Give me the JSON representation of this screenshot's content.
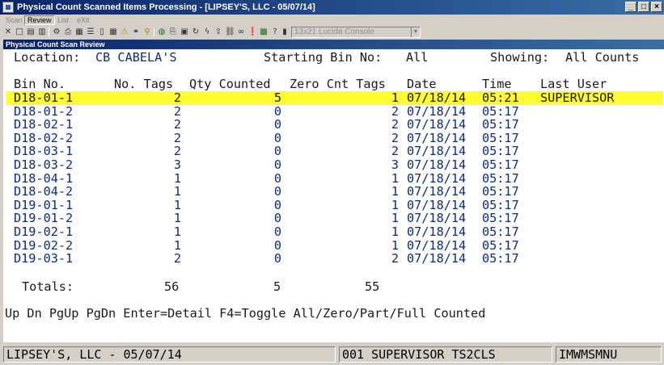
{
  "window": {
    "title": "Physical Count Scanned Items Processing - [LIPSEY'S, LLC - 05/07/14]"
  },
  "menu": [
    "Scan",
    "Review",
    "List",
    "eXit"
  ],
  "toolbar": {
    "font_select": "13x21 Lucida Console"
  },
  "child_window": {
    "title": "Physical Count Scan Review"
  },
  "header": {
    "location_label": "Location:",
    "location_value": "CB CABELA'S",
    "starting_bin_label": "Starting Bin No:",
    "starting_bin_value": "All",
    "showing_label": "Showing:",
    "showing_value": "All Counts"
  },
  "table": {
    "columns": [
      "Bin No.",
      "No. Tags",
      "Qty Counted",
      "Zero Cnt Tags",
      "Date",
      "Time",
      "Last User"
    ],
    "rows": [
      {
        "bin": "D18-01-1",
        "tags": "2",
        "qty": "5",
        "zero": "1",
        "date": "07/18/14",
        "time": "05:21",
        "user": "SUPERVISOR"
      },
      {
        "bin": "D18-01-2",
        "tags": "2",
        "qty": "0",
        "zero": "2",
        "date": "07/18/14",
        "time": "05:17",
        "user": ""
      },
      {
        "bin": "D18-02-1",
        "tags": "2",
        "qty": "0",
        "zero": "2",
        "date": "07/18/14",
        "time": "05:17",
        "user": ""
      },
      {
        "bin": "D18-02-2",
        "tags": "2",
        "qty": "0",
        "zero": "2",
        "date": "07/18/14",
        "time": "05:17",
        "user": ""
      },
      {
        "bin": "D18-03-1",
        "tags": "2",
        "qty": "0",
        "zero": "2",
        "date": "07/18/14",
        "time": "05:17",
        "user": ""
      },
      {
        "bin": "D18-03-2",
        "tags": "3",
        "qty": "0",
        "zero": "3",
        "date": "07/18/14",
        "time": "05:17",
        "user": ""
      },
      {
        "bin": "D18-04-1",
        "tags": "1",
        "qty": "0",
        "zero": "1",
        "date": "07/18/14",
        "time": "05:17",
        "user": ""
      },
      {
        "bin": "D18-04-2",
        "tags": "1",
        "qty": "0",
        "zero": "1",
        "date": "07/18/14",
        "time": "05:17",
        "user": ""
      },
      {
        "bin": "D19-01-1",
        "tags": "1",
        "qty": "0",
        "zero": "1",
        "date": "07/18/14",
        "time": "05:17",
        "user": ""
      },
      {
        "bin": "D19-01-2",
        "tags": "1",
        "qty": "0",
        "zero": "1",
        "date": "07/18/14",
        "time": "05:17",
        "user": ""
      },
      {
        "bin": "D19-02-1",
        "tags": "1",
        "qty": "0",
        "zero": "1",
        "date": "07/18/14",
        "time": "05:17",
        "user": ""
      },
      {
        "bin": "D19-02-2",
        "tags": "1",
        "qty": "0",
        "zero": "1",
        "date": "07/18/14",
        "time": "05:17",
        "user": ""
      },
      {
        "bin": "D19-03-1",
        "tags": "2",
        "qty": "0",
        "zero": "2",
        "date": "07/18/14",
        "time": "05:17",
        "user": ""
      }
    ]
  },
  "totals": {
    "label": "Totals:",
    "tags": "56",
    "qty": "5",
    "zero": "55"
  },
  "help_line": "Up Dn PgUp PgDn Enter=Detail F4=Toggle All/Zero/Part/Full Counted",
  "status": {
    "company": "LIPSEY'S, LLC - 05/07/14",
    "user": "001 SUPERVISOR TS2CLS",
    "program": "IMWMSMNU"
  },
  "colors": {
    "highlight": "#ffff33",
    "navy_text": "#0d2c7c",
    "titlebar": "#0a246a"
  }
}
